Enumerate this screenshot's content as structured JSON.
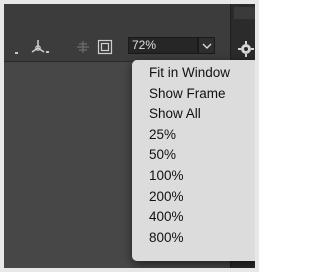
{
  "toolbar": {
    "tools": [
      {
        "name": "shape-dropdown-icon"
      },
      {
        "name": "transform-3d-icon"
      },
      {
        "name": "snap-grid-icon"
      },
      {
        "name": "frame-icon"
      }
    ],
    "zoom": {
      "value": "72%",
      "dropdown_icon": "chevron-down-icon"
    }
  },
  "side_panel": {
    "icon": "gear-icon"
  },
  "zoom_menu": {
    "items": [
      "Fit in Window",
      "Show Frame",
      "Show All",
      "25%",
      "50%",
      "100%",
      "200%",
      "400%",
      "800%"
    ]
  },
  "colors": {
    "toolbar_bg": "#3c3c3c",
    "canvas_bg": "#474747",
    "menu_bg": "#dcdcdc",
    "menu_text": "#111111"
  }
}
